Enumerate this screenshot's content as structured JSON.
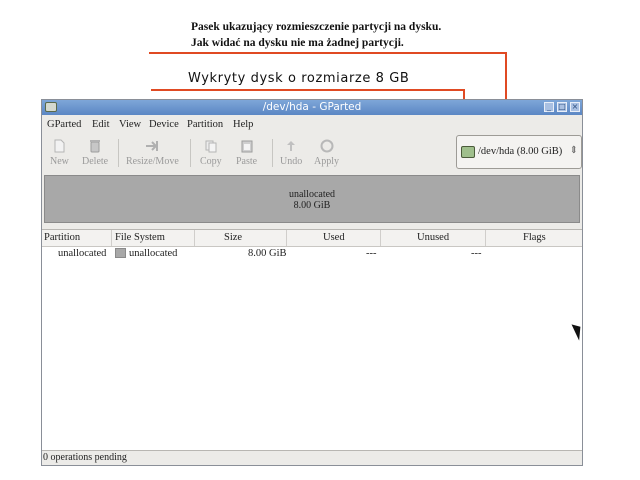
{
  "annotations": {
    "top_line1": "Pasek ukazujący rozmieszczenie partycji na dysku.",
    "top_line2": "Jak widać na dysku nie ma żadnej partycji.",
    "middle": "Wykryty dysk o rozmiarze 8 GB",
    "line_color": "#e04a23"
  },
  "window": {
    "title": "/dev/hda - GParted",
    "controls": [
      "minimize-icon",
      "maximize-icon",
      "close-icon"
    ]
  },
  "menu": {
    "items": [
      "GParted",
      "Edit",
      "View",
      "Device",
      "Partition",
      "Help"
    ]
  },
  "toolbar": {
    "new": "New",
    "delete": "Delete",
    "resize_move": "Resize/Move",
    "copy": "Copy",
    "paste": "Paste",
    "undo": "Undo",
    "apply": "Apply"
  },
  "device_selector": {
    "label": "/dev/hda  (8.00 GiB)",
    "icon": "harddisk-icon"
  },
  "partition_bar": {
    "name": "unallocated",
    "size": "8.00 GiB",
    "color": "#a8a8a8"
  },
  "table": {
    "columns": [
      "Partition",
      "File System",
      "Size",
      "Used",
      "Unused",
      "Flags"
    ],
    "rows": [
      {
        "partition": "unallocated",
        "filesystem": "unallocated",
        "size": "8.00 GiB",
        "used": "---",
        "unused": "---",
        "flags": ""
      }
    ]
  },
  "status": {
    "text": "0 operations pending"
  }
}
